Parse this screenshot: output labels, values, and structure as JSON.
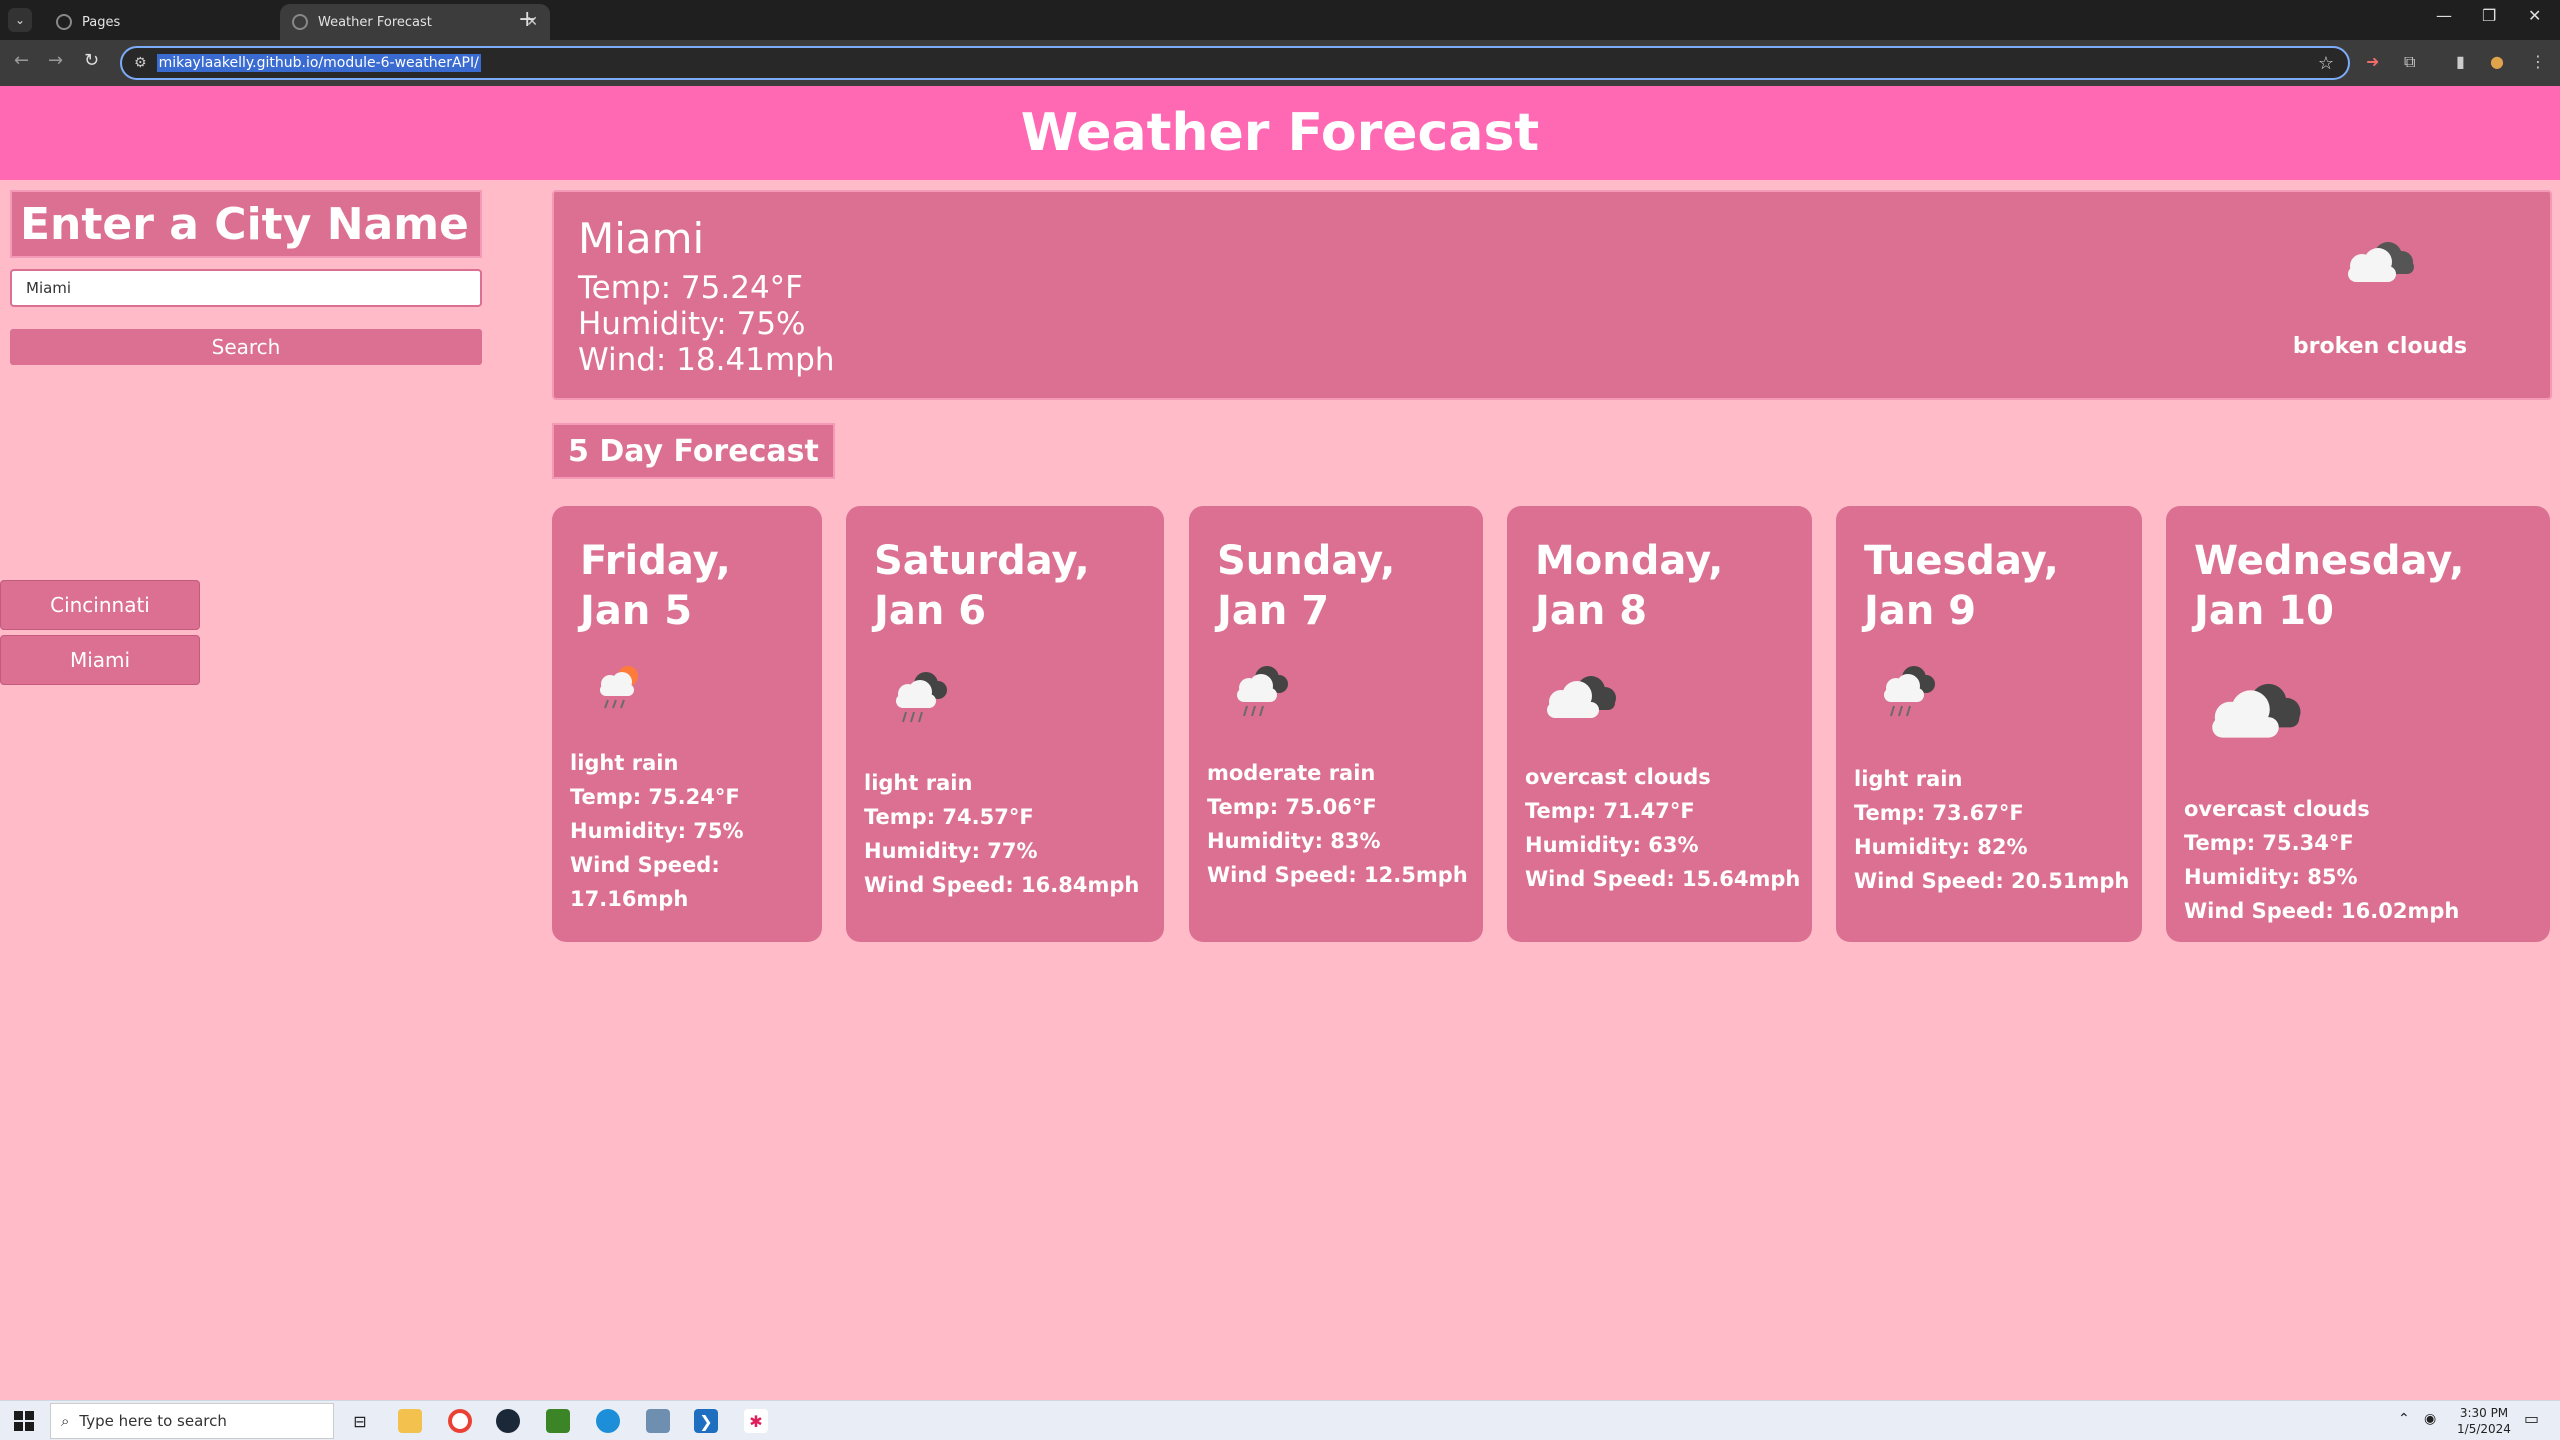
{
  "browser": {
    "tabs": [
      {
        "title": "Pages"
      },
      {
        "title": "Weather Forecast"
      }
    ],
    "url": "mikaylaakelly.github.io/module-6-weatherAPI/"
  },
  "page": {
    "title": "Weather Forecast",
    "search": {
      "heading": "Enter a City Name",
      "input_value": "Miami",
      "button_label": "Search"
    },
    "history": [
      "Cincinnati",
      "Miami"
    ],
    "current": {
      "city": "Miami",
      "temp": "Temp: 75.24°F",
      "humidity": "Humidity: 75%",
      "wind": "Wind: 18.41mph",
      "description": "broken clouds",
      "icon": "broken-clouds-icon"
    },
    "forecast_heading": "5 Day Forecast",
    "forecast": [
      {
        "day": "Friday,",
        "date": "Jan 5",
        "icon": "light-rain-sun-icon",
        "desc": "light rain",
        "temp": "Temp: 75.24°F",
        "humidity": "Humidity: 75%",
        "wind": "Wind Speed: 17.16mph"
      },
      {
        "day": "Saturday,",
        "date": "Jan 6",
        "icon": "rain-cloud-icon",
        "desc": "light rain",
        "temp": "Temp: 74.57°F",
        "humidity": "Humidity: 77%",
        "wind": "Wind Speed: 16.84mph"
      },
      {
        "day": "Sunday,",
        "date": "Jan 7",
        "icon": "rain-cloud-icon",
        "desc": "moderate rain",
        "temp": "Temp: 75.06°F",
        "humidity": "Humidity: 83%",
        "wind": "Wind Speed: 12.5mph"
      },
      {
        "day": "Monday,",
        "date": "Jan 8",
        "icon": "overcast-clouds-icon",
        "desc": "overcast clouds",
        "temp": "Temp: 71.47°F",
        "humidity": "Humidity: 63%",
        "wind": "Wind Speed: 15.64mph"
      },
      {
        "day": "Tuesday,",
        "date": "Jan 9",
        "icon": "rain-cloud-icon",
        "desc": "light rain",
        "temp": "Temp: 73.67°F",
        "humidity": "Humidity: 82%",
        "wind": "Wind Speed: 20.51mph"
      },
      {
        "day": "Wednesday,",
        "date": "Jan 10",
        "icon": "overcast-clouds-icon",
        "desc": "overcast clouds",
        "temp": "Temp: 75.34°F",
        "humidity": "Humidity: 85%",
        "wind": "Wind Speed: 16.02mph"
      }
    ]
  },
  "taskbar": {
    "search_placeholder": "Type here to search",
    "time": "3:30 PM",
    "date": "1/5/2024"
  },
  "colors": {
    "header": "#ff69b4",
    "panel": "#db7093",
    "background": "#ffbcc8"
  }
}
